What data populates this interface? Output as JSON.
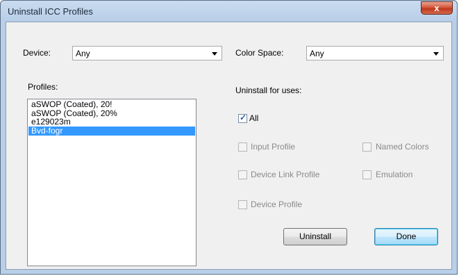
{
  "window": {
    "title": "Uninstall ICC Profiles",
    "close_glyph": "x"
  },
  "device": {
    "label": "Device:",
    "value": "Any"
  },
  "color_space": {
    "label": "Color Space:",
    "value": "Any"
  },
  "profiles": {
    "label": "Profiles:",
    "items": [
      "aSWOP (Coated), 20!",
      "aSWOP (Coated), 20%",
      "e129023m",
      "Bvd-fogr"
    ],
    "selected_index": 3
  },
  "uses": {
    "label": "Uninstall for uses:",
    "all": {
      "label": "All",
      "checked": true
    },
    "input_profile": {
      "label": "Input Profile",
      "checked": false
    },
    "named_colors": {
      "label": "Named Colors",
      "checked": false
    },
    "device_link_profile": {
      "label": "Device Link Profile",
      "checked": false
    },
    "emulation": {
      "label": "Emulation",
      "checked": false
    },
    "device_profile": {
      "label": "Device Profile",
      "checked": false
    }
  },
  "buttons": {
    "uninstall": "Uninstall",
    "done": "Done"
  }
}
